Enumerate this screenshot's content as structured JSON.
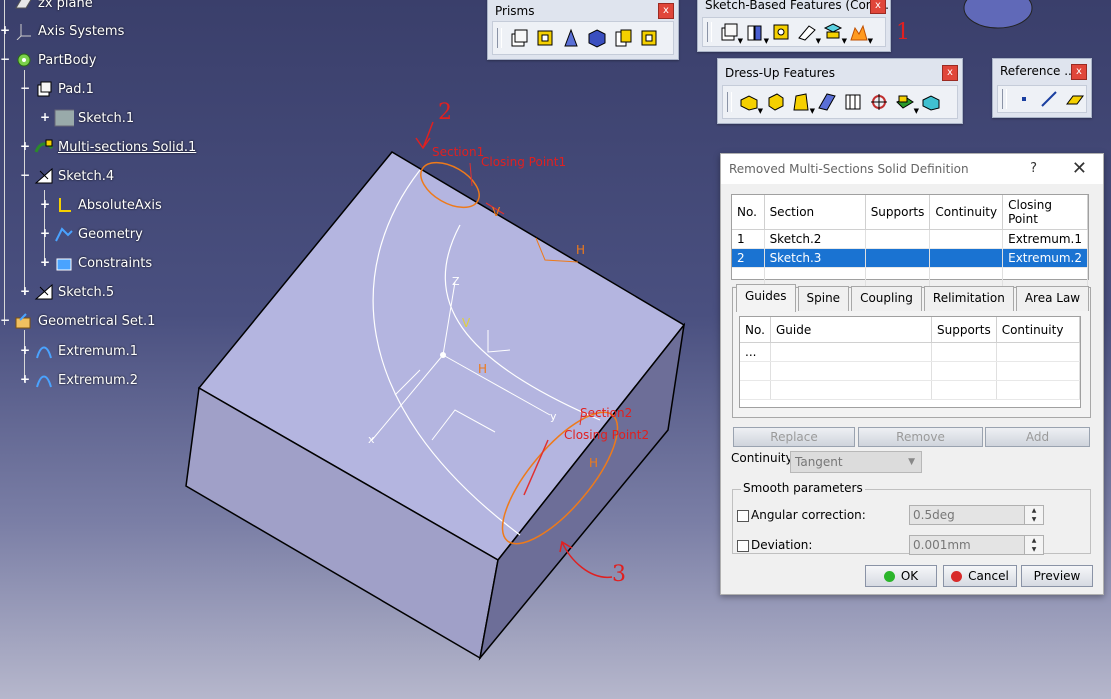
{
  "tree": {
    "items": [
      {
        "label": "zx plane",
        "icon": "plane-icon"
      },
      {
        "label": "Axis Systems",
        "icon": "axis-icon"
      },
      {
        "label": "PartBody",
        "icon": "gear-icon"
      },
      {
        "label": "Pad.1",
        "icon": "pad-icon"
      },
      {
        "label": "Sketch.1",
        "icon": "sketch-icon"
      },
      {
        "label": "Multi-sections Solid.1",
        "icon": "multisection-icon"
      },
      {
        "label": "Sketch.4",
        "icon": "sketch-icon"
      },
      {
        "label": "AbsoluteAxis",
        "icon": "axis-icon"
      },
      {
        "label": "Geometry",
        "icon": "geometry-icon"
      },
      {
        "label": "Constraints",
        "icon": "constraints-icon"
      },
      {
        "label": "Sketch.5",
        "icon": "sketch-icon"
      },
      {
        "label": "Geometrical Set.1",
        "icon": "geoset-icon"
      },
      {
        "label": "Extremum.1",
        "icon": "extremum-icon"
      },
      {
        "label": "Extremum.2",
        "icon": "extremum-icon"
      }
    ]
  },
  "toolbars": {
    "prisms": {
      "title": "Prisms",
      "close": "x"
    },
    "sketch_based": {
      "title": "Sketch-Based Features (Com...",
      "close": "x"
    },
    "dress_up": {
      "title": "Dress-Up Features",
      "close": "x"
    },
    "reference": {
      "title": "Reference ...",
      "close": "x"
    }
  },
  "viewport": {
    "labels": {
      "section1": "Section1",
      "closing1": "Closing Point1",
      "section2": "Section2",
      "closing2": "Closing Point2",
      "h1": "H",
      "v1": "V",
      "h2": "H",
      "h3": "H",
      "v3": "V",
      "z": "Z",
      "y": "y",
      "x": "x"
    },
    "annotations": {
      "a1": "1",
      "a2": "2",
      "a3": "3"
    }
  },
  "dialog": {
    "title": "Removed Multi-Sections Solid Definition",
    "help": "?",
    "close": "✕",
    "sections": {
      "headers": [
        "No.",
        "Section",
        "Supports",
        "Continuity",
        "Closing Point"
      ],
      "rows": [
        {
          "no": "1",
          "section": "Sketch.2",
          "supports": "",
          "continuity": "",
          "closing": "Extremum.1"
        },
        {
          "no": "2",
          "section": "Sketch.3",
          "supports": "",
          "continuity": "",
          "closing": "Extremum.2"
        }
      ]
    },
    "tabs": [
      "Guides",
      "Spine",
      "Coupling",
      "Relimitation",
      "Area Law"
    ],
    "guides": {
      "headers": [
        "No.",
        "Guide",
        "Supports",
        "Continuity"
      ],
      "row_placeholder": "..."
    },
    "buttons": {
      "replace": "Replace",
      "remove": "Remove",
      "add": "Add"
    },
    "continuity_label": "Continuity:",
    "continuity_value": "Tangent",
    "smooth": {
      "legend": "Smooth parameters",
      "angular_label": "Angular correction:",
      "angular_value": "0.5deg",
      "deviation_label": "Deviation:",
      "deviation_value": "0.001mm"
    },
    "ok": "OK",
    "cancel": "Cancel",
    "preview": "Preview"
  }
}
